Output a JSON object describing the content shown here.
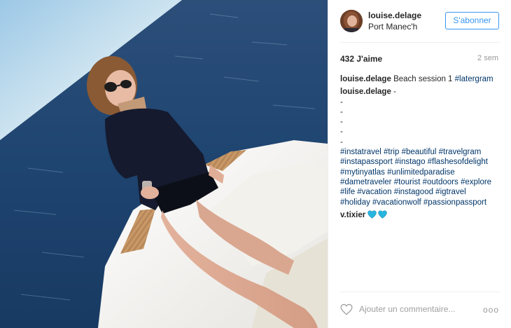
{
  "post": {
    "username": "louise.delage",
    "location": "Port Manec'h",
    "follow_label": "S'abonner",
    "likes": "432 J'aime",
    "time_ago": "2 sem"
  },
  "caption": {
    "user": "louise.delage",
    "text": "Beach session 1",
    "tag": "#latergram"
  },
  "hashtag_comment": {
    "user": "louise.delage",
    "first": "-",
    "dashes": [
      "-",
      "-",
      "-",
      "-",
      "-"
    ],
    "tag_lines": [
      "#instatravel #trip #beautiful #travelgram",
      "#instapassport #instago #flashesofdelight",
      "#mytinyatlas #unlimitedparadise",
      "#dametraveler #tourist #outdoors #explore",
      "#life #vacation #instagood #igtravel",
      "#holiday #vacationwolf #passionpassport"
    ]
  },
  "reply": {
    "user": "v.tixier",
    "hearts": [
      "blue-heart-icon",
      "blue-heart-icon"
    ],
    "heart_color": "#28b5e0"
  },
  "footer": {
    "placeholder": "Ajouter un commentaire...",
    "more": "ooo"
  },
  "colors": {
    "accent": "#3897f0",
    "hashtag": "#003569",
    "muted": "#999999"
  }
}
